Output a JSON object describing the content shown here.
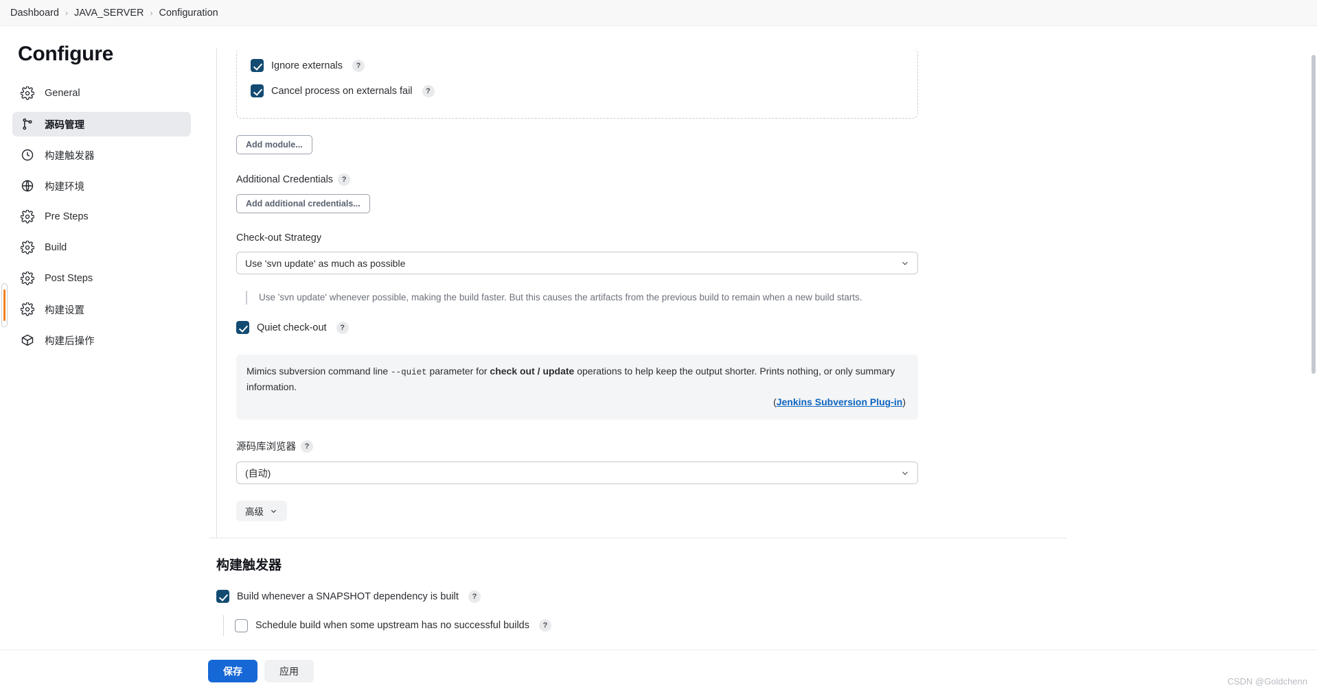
{
  "breadcrumb": {
    "items": [
      "Dashboard",
      "JAVA_SERVER",
      "Configuration"
    ],
    "separator": "›"
  },
  "sidebar": {
    "title": "Configure",
    "items": [
      {
        "label": "General",
        "icon": "gear-icon"
      },
      {
        "label": "源码管理",
        "icon": "source-branch-icon"
      },
      {
        "label": "构建触发器",
        "icon": "clock-icon"
      },
      {
        "label": "构建环境",
        "icon": "globe-icon"
      },
      {
        "label": "Pre Steps",
        "icon": "gear-icon"
      },
      {
        "label": "Build",
        "icon": "gear-icon"
      },
      {
        "label": "Post Steps",
        "icon": "gear-icon"
      },
      {
        "label": "构建设置",
        "icon": "gear-icon"
      },
      {
        "label": "构建后操作",
        "icon": "package-icon"
      }
    ],
    "active_index": 1
  },
  "main": {
    "module": {
      "checkboxes": [
        {
          "label": "Ignore externals",
          "checked": true,
          "help": "?"
        },
        {
          "label": "Cancel process on externals fail",
          "checked": true,
          "help": "?"
        }
      ]
    },
    "add_module_button": "Add module...",
    "additional_credentials": {
      "label": "Additional Credentials",
      "help": "?",
      "button": "Add additional credentials..."
    },
    "checkout_strategy": {
      "label": "Check-out Strategy",
      "selected": "Use 'svn update' as much as possible",
      "note": "Use 'svn update' whenever possible, making the build faster. But this causes the artifacts from the previous build to remain when a new build starts."
    },
    "quiet_checkout": {
      "label": "Quiet check-out",
      "checked": true,
      "help": "?",
      "panel_before": "Mimics subversion command line ",
      "panel_code": "--quiet",
      "panel_mid": " parameter for ",
      "panel_bold": "check out / update",
      "panel_after": " operations to help keep the output shorter. Prints nothing, or only summary information.",
      "link_open": "(",
      "link_text": "Jenkins Subversion Plug-in",
      "link_close": ")"
    },
    "repo_browser": {
      "label": "源码库浏览器",
      "help": "?",
      "selected": "(自动)"
    },
    "advanced_button": "高级"
  },
  "build_triggers": {
    "heading": "构建触发器",
    "items": [
      {
        "label": "Build whenever a SNAPSHOT dependency is built",
        "checked": true,
        "help": "?",
        "nested": false
      },
      {
        "label": "Schedule build when some upstream has no successful builds",
        "checked": false,
        "help": "?",
        "nested": true
      }
    ]
  },
  "footer": {
    "save_label": "保存",
    "apply_label": "应用"
  },
  "watermark": "CSDN @Goldchenn",
  "colors": {
    "accent_blue": "#1668d6",
    "checkbox_navy": "#134b72",
    "link_blue": "#0b64c0",
    "scroll_orange": "#f2801e"
  }
}
